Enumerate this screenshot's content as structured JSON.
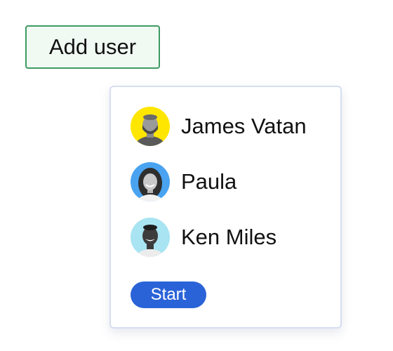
{
  "add_user": {
    "label": "Add user"
  },
  "user_list": {
    "users": [
      {
        "name": "James Vatan",
        "avatar_bg": "#ffe600"
      },
      {
        "name": "Paula",
        "avatar_bg": "#4aa3f0"
      },
      {
        "name": "Ken Miles",
        "avatar_bg": "#a8e4f2"
      }
    ],
    "start_label": "Start",
    "start_color": "#2a63d8"
  }
}
